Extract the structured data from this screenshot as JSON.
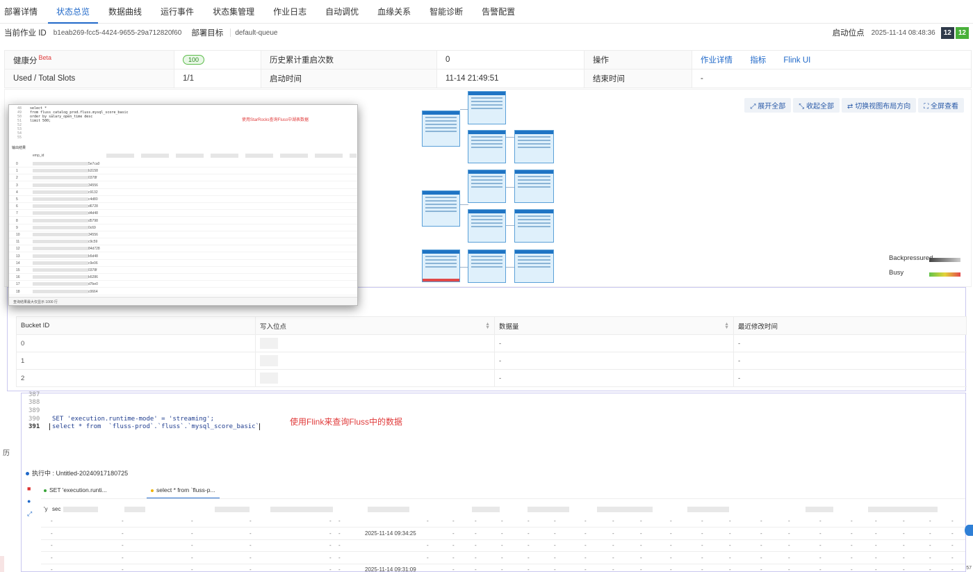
{
  "tabs": [
    {
      "label": "部署详情",
      "active": false
    },
    {
      "label": "状态总览",
      "active": true
    },
    {
      "label": "数据曲线",
      "active": false
    },
    {
      "label": "运行事件",
      "active": false
    },
    {
      "label": "状态集管理",
      "active": false
    },
    {
      "label": "作业日志",
      "active": false
    },
    {
      "label": "自动调优",
      "active": false
    },
    {
      "label": "血缘关系",
      "active": false
    },
    {
      "label": "智能诊断",
      "active": false
    },
    {
      "label": "告警配置",
      "active": false
    }
  ],
  "jobinfo": {
    "job_id_label": "当前作业 ID",
    "job_id": "b1eab269-fcc5-4424-9655-29a712820f60",
    "target_label": "部署目标",
    "target": "default-queue",
    "start_label": "启动位点",
    "start_time": "2025-11-14 08:48:36",
    "badge_a": "12",
    "badge_b": "12"
  },
  "summary": {
    "health_label": "健康分",
    "health_beta": "Beta",
    "health_score": "100",
    "restart_label": "历史累计重启次数",
    "restart_count": "0",
    "ops_label": "操作",
    "ops_links": [
      "作业详情",
      "指标",
      "Flink UI"
    ],
    "slots_label": "Used / Total Slots",
    "slots_value": "1/1",
    "start_time_label": "启动时间",
    "start_time_value": "11-14 21:49:51",
    "end_time_label": "结束时间",
    "end_time_value": "-"
  },
  "graph": {
    "tools": [
      "展开全部",
      "收起全部",
      "切换视图布局方向",
      "全屏查看"
    ],
    "legend": [
      {
        "label": "Backpressured",
        "colors": [
          "#444444",
          "#cccccc"
        ]
      },
      {
        "label": "Busy",
        "colors": [
          "#63c34a",
          "#e3474a"
        ]
      }
    ]
  },
  "starrocks": {
    "code_lines": [
      {
        "ln": "48",
        "text": "select *"
      },
      {
        "ln": "49",
        "text": "from fluss_catalog_prod.fluss.mysql_score_basic"
      },
      {
        "ln": "50",
        "text": "order by salary_open_time desc"
      },
      {
        "ln": "51",
        "text": "limit 500;"
      },
      {
        "ln": "52",
        "text": ""
      },
      {
        "ln": "53",
        "text": ""
      },
      {
        "ln": "54",
        "text": ""
      },
      {
        "ln": "55",
        "text": ""
      }
    ],
    "note": "使用StarRocks查询Fluss中湖表数据",
    "result_tab": "输出结果",
    "col_header": "emp_id",
    "rows": [
      {
        "idx": "0",
        "val": "5e7ca0"
      },
      {
        "idx": "1",
        "val": "b3158"
      },
      {
        "idx": "2",
        "val": "0378f"
      },
      {
        "idx": "3",
        "val": "34556"
      },
      {
        "idx": "4",
        "val": "c9132"
      },
      {
        "idx": "5",
        "val": "c4d80"
      },
      {
        "idx": "6",
        "val": "d6728"
      },
      {
        "idx": "7",
        "val": "d4d48"
      },
      {
        "idx": "8",
        "val": "d5798"
      },
      {
        "idx": "9",
        "val": "0c69"
      },
      {
        "idx": "10",
        "val": "34556"
      },
      {
        "idx": "11",
        "val": "c9c59"
      },
      {
        "idx": "12",
        "val": "84d728"
      },
      {
        "idx": "13",
        "val": "b5d48"
      },
      {
        "idx": "14",
        "val": "c9e06"
      },
      {
        "idx": "15",
        "val": "0378f"
      },
      {
        "idx": "16",
        "val": "b5286"
      },
      {
        "idx": "17",
        "val": "d7be0"
      },
      {
        "idx": "18",
        "val": "c0664"
      }
    ],
    "footer": "查询结果最大仅显示 1000 行"
  },
  "buckets": {
    "headers": [
      "Bucket ID",
      "写入位点",
      "数据量",
      "最近修改时间"
    ],
    "rows": [
      {
        "id": "0",
        "size": "-",
        "mtime": "-"
      },
      {
        "id": "1",
        "size": "-",
        "mtime": "-"
      },
      {
        "id": "2",
        "size": "-",
        "mtime": "-"
      }
    ]
  },
  "flink": {
    "code_lines": [
      {
        "ln": "387",
        "text": ""
      },
      {
        "ln": "388",
        "text": ""
      },
      {
        "ln": "389",
        "text": ""
      },
      {
        "ln": "390",
        "text": "SET 'execution.runtime-mode' = 'streaming';"
      },
      {
        "ln": "391",
        "text": "select * from  `fluss-prod`.`fluss`.`mysql_score_basic`"
      }
    ],
    "note": "使用Flink来查询Fluss中的数据",
    "exec_label": "执行中 : Untitled-20240917180725",
    "result_tabs": [
      "SET 'execution.runti...",
      "select * from `fluss-p..."
    ],
    "res_head_a": "'y",
    "res_head_b": "sec",
    "timestamps": [
      "",
      "2025-11-14 09:34:25",
      "",
      "",
      "2025-11-14 09:31:09"
    ],
    "corner": "57",
    "left_char": "历"
  }
}
